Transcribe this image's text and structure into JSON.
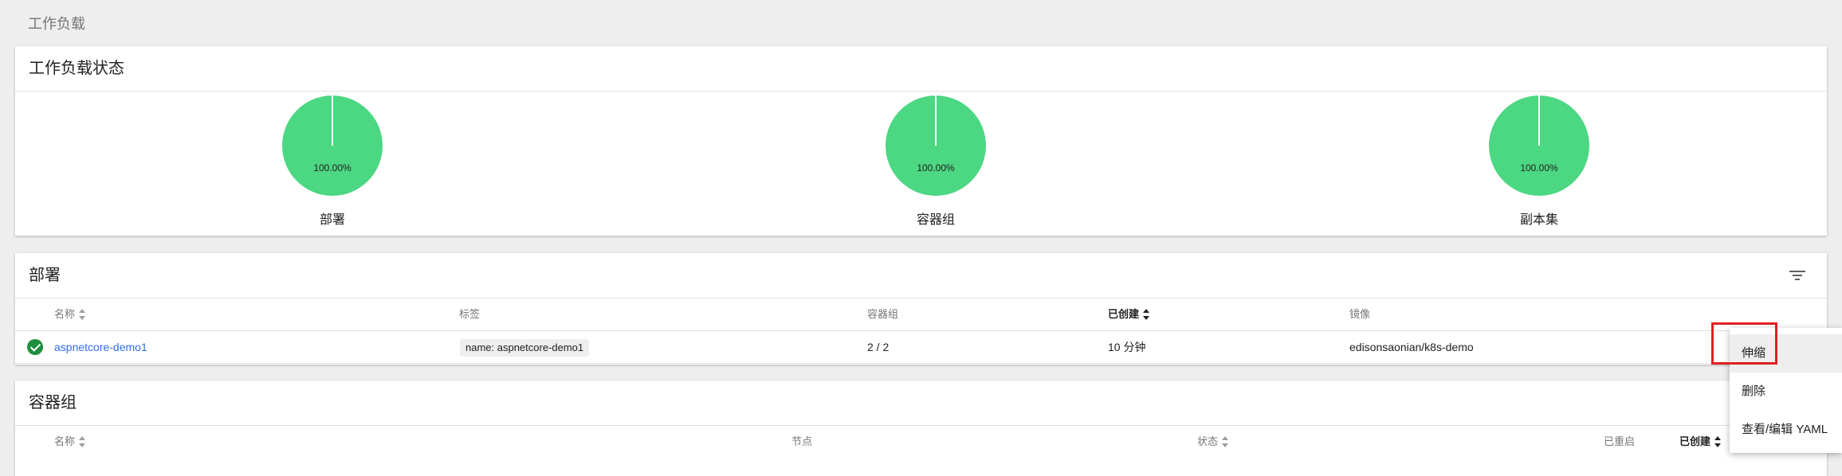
{
  "breadcrumb": "工作负载",
  "status_card": {
    "title": "工作负载状态",
    "charts": [
      {
        "label": "部署",
        "percent": "100.00%",
        "value": 100
      },
      {
        "label": "容器组",
        "percent": "100.00%",
        "value": 100
      },
      {
        "label": "副本集",
        "percent": "100.00%",
        "value": 100
      }
    ],
    "colors": {
      "success": "#4cd782"
    }
  },
  "deployments": {
    "title": "部署",
    "filter_icon": "filter-icon",
    "columns": {
      "name": "名称",
      "labels": "标签",
      "pods": "容器组",
      "created": "已创建",
      "image": "镜像"
    },
    "rows": [
      {
        "status": "check-circle-icon",
        "name": "aspnetcore-demo1",
        "label": "name: aspnetcore-demo1",
        "pods": "2 / 2",
        "created": "10 分钟",
        "image": "edisonsaonian/k8s-demo"
      }
    ]
  },
  "pods": {
    "title": "容器组",
    "columns": {
      "name": "名称",
      "node": "节点",
      "status": "状态",
      "restarts": "已重启",
      "created": "已创建"
    }
  },
  "context_menu": {
    "items": [
      "伸缩",
      "删除",
      "查看/编辑 YAML"
    ],
    "highlighted": "伸缩"
  }
}
